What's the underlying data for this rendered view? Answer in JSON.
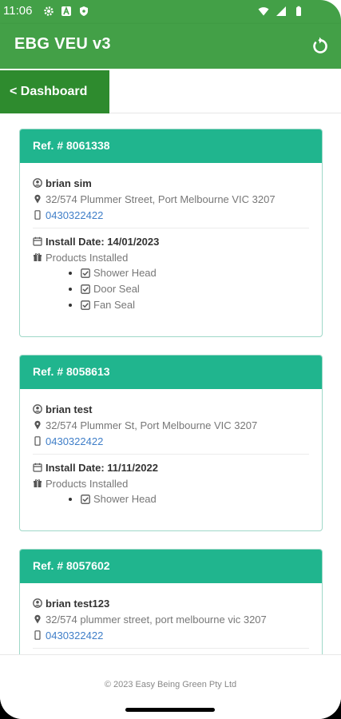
{
  "status_bar": {
    "time": "11:06",
    "icons_left": [
      "gear-icon",
      "a-icon",
      "shield-icon"
    ],
    "icons_right": [
      "wifi-icon",
      "signal-icon",
      "battery-icon"
    ]
  },
  "app_bar": {
    "title": "EBG VEU v3",
    "refresh_icon": "refresh-icon"
  },
  "nav": {
    "back_label": "< Dashboard"
  },
  "colors": {
    "app_green": "#43a047",
    "dash_green": "#2e8b2e",
    "card_teal": "#20b58e",
    "link_blue": "#3f7ec8"
  },
  "jobs": [
    {
      "ref": "Ref. # 8061338",
      "name": "brian sim",
      "address": "32/574 Plummer Street, Port Melbourne VIC 3207",
      "phone": "0430322422",
      "install_date": "Install Date: 14/01/2023",
      "products_label": "Products Installed",
      "products": [
        "Shower Head",
        "Door Seal",
        "Fan Seal"
      ]
    },
    {
      "ref": "Ref. # 8058613",
      "name": "brian test",
      "address": "32/574 Plummer St, Port Melbourne VIC 3207",
      "phone": "0430322422",
      "install_date": "Install Date: 11/11/2022",
      "products_label": "Products Installed",
      "products": [
        "Shower Head"
      ]
    },
    {
      "ref": "Ref. # 8057602",
      "name": "brian test123",
      "address": "32/574 plummer street, port melbourne vic 3207",
      "phone": "0430322422"
    }
  ],
  "footer": {
    "copyright": "© 2023 Easy Being Green Pty Ltd"
  }
}
